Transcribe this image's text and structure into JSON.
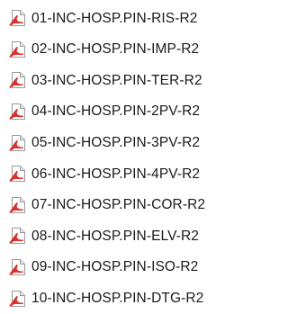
{
  "files": [
    {
      "name": "01-INC-HOSP.PIN-RIS-R2",
      "icon": "pdf-file-icon"
    },
    {
      "name": "02-INC-HOSP.PIN-IMP-R2",
      "icon": "pdf-file-icon"
    },
    {
      "name": "03-INC-HOSP.PIN-TER-R2",
      "icon": "pdf-file-icon"
    },
    {
      "name": "04-INC-HOSP.PIN-2PV-R2",
      "icon": "pdf-file-icon"
    },
    {
      "name": "05-INC-HOSP.PIN-3PV-R2",
      "icon": "pdf-file-icon"
    },
    {
      "name": "06-INC-HOSP.PIN-4PV-R2",
      "icon": "pdf-file-icon"
    },
    {
      "name": "07-INC-HOSP.PIN-COR-R2",
      "icon": "pdf-file-icon"
    },
    {
      "name": "08-INC-HOSP.PIN-ELV-R2",
      "icon": "pdf-file-icon"
    },
    {
      "name": "09-INC-HOSP.PIN-ISO-R2",
      "icon": "pdf-file-icon"
    },
    {
      "name": "10-INC-HOSP.PIN-DTG-R2",
      "icon": "pdf-file-icon"
    }
  ],
  "colors": {
    "icon_accent": "#d9302b",
    "icon_page": "#ffffff",
    "icon_border": "#9a9a9a",
    "text": "#1a1a1a"
  }
}
